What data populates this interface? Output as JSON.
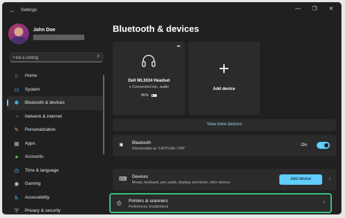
{
  "window": {
    "app_title": "Settings"
  },
  "profile": {
    "name": "John Doe"
  },
  "search": {
    "placeholder": "Find a setting"
  },
  "sidebar": {
    "items": [
      {
        "label": "Home",
        "icon": "home-icon"
      },
      {
        "label": "System",
        "icon": "monitor-icon"
      },
      {
        "label": "Bluetooth & devices",
        "icon": "bluetooth-icon"
      },
      {
        "label": "Network & internet",
        "icon": "wifi-icon"
      },
      {
        "label": "Personalization",
        "icon": "brush-icon"
      },
      {
        "label": "Apps",
        "icon": "apps-icon"
      },
      {
        "label": "Accounts",
        "icon": "person-icon"
      },
      {
        "label": "Time & language",
        "icon": "globe-clock-icon"
      },
      {
        "label": "Gaming",
        "icon": "gamepad-icon"
      },
      {
        "label": "Accessibility",
        "icon": "accessibility-icon"
      },
      {
        "label": "Privacy & security",
        "icon": "shield-icon"
      }
    ],
    "active_index": 2
  },
  "main": {
    "page_title": "Bluetooth & devices",
    "device_card": {
      "name": "Dell WL3024 Headset",
      "status": "Connected mic, audio",
      "battery": "96%",
      "more": "•••"
    },
    "add_card": {
      "label": "Add device"
    },
    "view_more": "View more devices",
    "bluetooth": {
      "title": "Bluetooth",
      "subtitle": "Discoverable as \"LATITUDE-7340\"",
      "toggle_label": "On",
      "toggle_on": true
    },
    "devices": {
      "title": "Devices",
      "subtitle": "Mouse, keyboard, pen, audio, displays and docks, other devices",
      "button": "Add device"
    },
    "printers": {
      "title": "Printers & scanners",
      "subtitle": "Preferences, troubleshoot"
    }
  },
  "colors": {
    "accent": "#60cdff",
    "highlight": "#3fbf82",
    "background": "#202020",
    "card": "#2b2b2b"
  }
}
